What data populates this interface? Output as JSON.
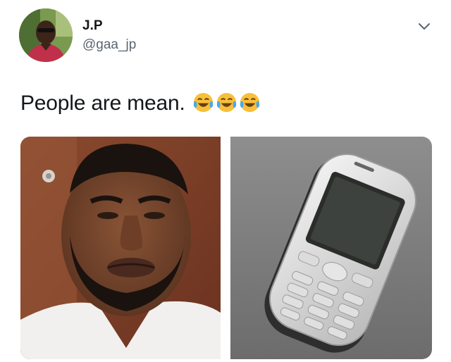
{
  "tweet": {
    "display_name": "J.P",
    "handle": "@gaa_jp",
    "text": "People are mean.",
    "emojis": [
      "face-with-tears-of-joy",
      "face-with-tears-of-joy",
      "face-with-tears-of-joy"
    ]
  },
  "icons": {
    "more_menu": "chevron-down-icon"
  },
  "colors": {
    "text": "#14171a",
    "secondary_text": "#5a6570",
    "emoji_yellow": "#f7c03a",
    "tear_blue": "#4aa8e8"
  }
}
